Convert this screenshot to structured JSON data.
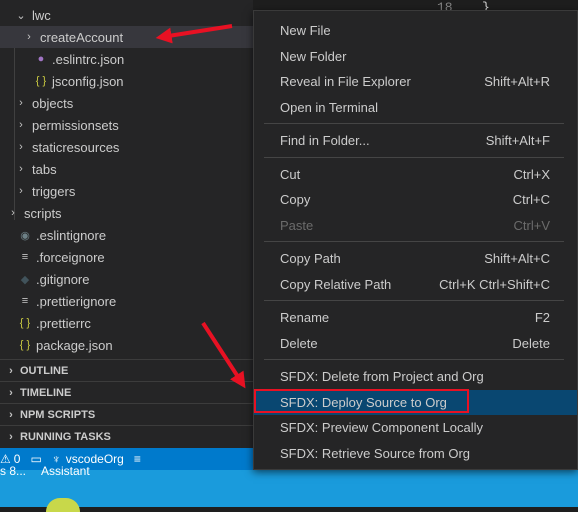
{
  "editor": {
    "line_number": "18",
    "code": "}"
  },
  "explorer": {
    "items": [
      {
        "label": "lwc",
        "chevron": "⌄",
        "icon": "",
        "icon_color": "",
        "indent": 30
      },
      {
        "label": "createAccount",
        "chevron": "›",
        "icon": "",
        "icon_color": "",
        "indent": 38
      },
      {
        "label": ".eslintrc.json",
        "chevron": "",
        "icon": "●",
        "icon_color": "#a074c4",
        "indent": 38
      },
      {
        "label": "jsconfig.json",
        "chevron": "",
        "icon": "{ }",
        "icon_color": "#cbcb41",
        "indent": 38
      },
      {
        "label": "objects",
        "chevron": "›",
        "icon": "",
        "icon_color": "",
        "indent": 30
      },
      {
        "label": "permissionsets",
        "chevron": "›",
        "icon": "",
        "icon_color": "",
        "indent": 30
      },
      {
        "label": "staticresources",
        "chevron": "›",
        "icon": "",
        "icon_color": "",
        "indent": 30
      },
      {
        "label": "tabs",
        "chevron": "›",
        "icon": "",
        "icon_color": "",
        "indent": 30
      },
      {
        "label": "triggers",
        "chevron": "›",
        "icon": "",
        "icon_color": "",
        "indent": 30
      },
      {
        "label": "scripts",
        "chevron": "›",
        "icon": "",
        "icon_color": "",
        "indent": 22
      },
      {
        "label": ".eslintignore",
        "chevron": "",
        "icon": "◉",
        "icon_color": "#6d8086",
        "indent": 22
      },
      {
        "label": ".forceignore",
        "chevron": "",
        "icon": "≡",
        "icon_color": "#c5c5c5",
        "indent": 22
      },
      {
        "label": ".gitignore",
        "chevron": "",
        "icon": "◆",
        "icon_color": "#41535b",
        "indent": 22
      },
      {
        "label": ".prettierignore",
        "chevron": "",
        "icon": "≡",
        "icon_color": "#c5c5c5",
        "indent": 22
      },
      {
        "label": ".prettierrc",
        "chevron": "",
        "icon": "{ }",
        "icon_color": "#cbcb41",
        "indent": 22
      },
      {
        "label": "package.json",
        "chevron": "",
        "icon": "{ }",
        "icon_color": "#cbcb41",
        "indent": 22
      }
    ],
    "selected_item": "createAccount"
  },
  "panels": [
    {
      "label": "OUTLINE"
    },
    {
      "label": "TIMELINE"
    },
    {
      "label": "NPM SCRIPTS"
    },
    {
      "label": "RUNNING TASKS"
    }
  ],
  "statusbar": {
    "problems_icon": "warning-icon",
    "problems_count": "0",
    "org_name": "vscodeOrg"
  },
  "taskbar": {
    "partial_text": "s 8...",
    "assistant_label": "Assistant"
  },
  "context_menu": {
    "groups": [
      [
        {
          "label": "New File",
          "shortcut": ""
        },
        {
          "label": "New Folder",
          "shortcut": ""
        },
        {
          "label": "Reveal in File Explorer",
          "shortcut": "Shift+Alt+R"
        },
        {
          "label": "Open in Terminal",
          "shortcut": ""
        }
      ],
      [
        {
          "label": "Find in Folder...",
          "shortcut": "Shift+Alt+F"
        }
      ],
      [
        {
          "label": "Cut",
          "shortcut": "Ctrl+X"
        },
        {
          "label": "Copy",
          "shortcut": "Ctrl+C"
        },
        {
          "label": "Paste",
          "shortcut": "Ctrl+V",
          "disabled": true
        }
      ],
      [
        {
          "label": "Copy Path",
          "shortcut": "Shift+Alt+C"
        },
        {
          "label": "Copy Relative Path",
          "shortcut": "Ctrl+K Ctrl+Shift+C"
        }
      ],
      [
        {
          "label": "Rename",
          "shortcut": "F2"
        },
        {
          "label": "Delete",
          "shortcut": "Delete"
        }
      ],
      [
        {
          "label": "SFDX: Delete from Project and Org",
          "shortcut": ""
        },
        {
          "label": "SFDX: Deploy Source to Org",
          "shortcut": "",
          "highlighted": true
        },
        {
          "label": "SFDX: Preview Component Locally",
          "shortcut": ""
        },
        {
          "label": "SFDX: Retrieve Source from Org",
          "shortcut": ""
        }
      ]
    ]
  },
  "annotation_color": "#e81123"
}
